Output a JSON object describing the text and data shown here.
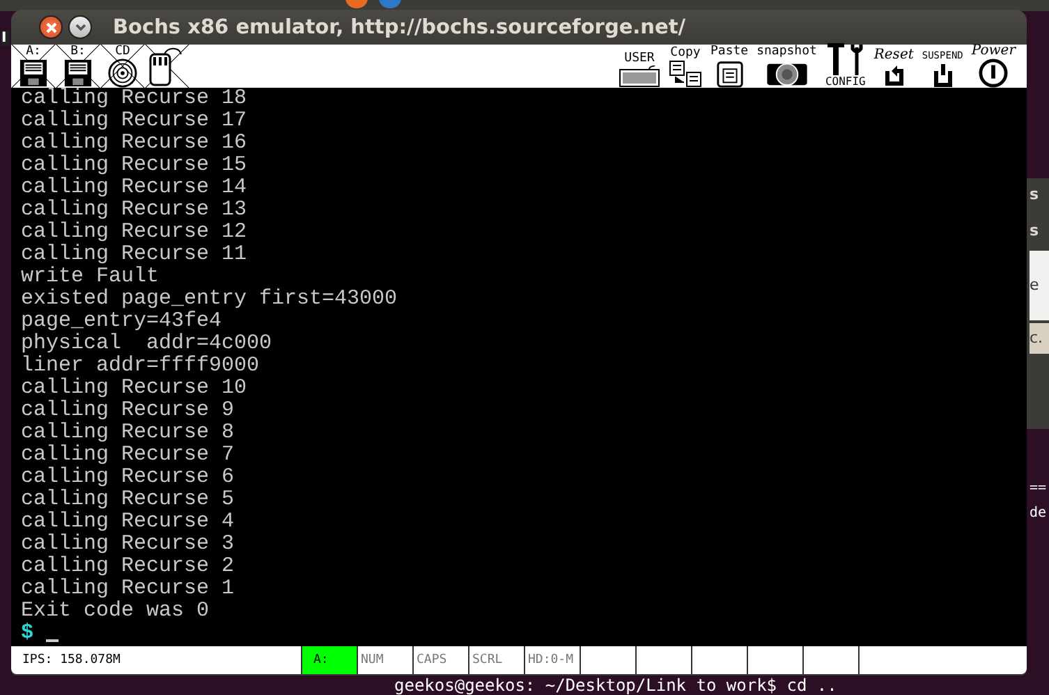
{
  "desktop": {
    "left_label": "I",
    "right_fragments": [
      {
        "text": "s",
        "kind": "dark"
      },
      {
        "text": "s",
        "kind": "dark"
      },
      {
        "text": "e",
        "kind": "light"
      },
      {
        "text": "c.",
        "kind": "beige"
      },
      {
        "text": "==",
        "kind": "term"
      },
      {
        "text": "de",
        "kind": "term"
      }
    ],
    "terminal_line": "geekos@geekos: ~/Desktop/Link to work$ cd .."
  },
  "window": {
    "title": "Bochs x86 emulator, http://bochs.sourceforge.net/"
  },
  "toolbar_left": [
    {
      "label": "A:",
      "kind": "floppy"
    },
    {
      "label": "B:",
      "kind": "floppy"
    },
    {
      "label": "CD",
      "kind": "cdrom"
    },
    {
      "kind": "mouse"
    }
  ],
  "toolbar_right": [
    {
      "label": "USER",
      "kind": "keyboard"
    },
    {
      "label": "Copy",
      "kind": "copy"
    },
    {
      "label": "Paste",
      "kind": "paste"
    },
    {
      "label": "snapshot",
      "kind": "camera"
    },
    {
      "label": "CONFIG",
      "kind": "config"
    },
    {
      "label": "Reset",
      "kind": "reset"
    },
    {
      "label": "SUSPEND",
      "kind": "suspend"
    },
    {
      "label": "Power",
      "kind": "power"
    }
  ],
  "console_lines": [
    {
      "text": "calling Recurse 18"
    },
    {
      "text": "calling Recurse 17"
    },
    {
      "text": "calling Recurse 16"
    },
    {
      "text": "calling Recurse 15"
    },
    {
      "text": "calling Recurse 14"
    },
    {
      "text": "calling Recurse 13"
    },
    {
      "text": "calling Recurse 12"
    },
    {
      "text": "calling Recurse 11"
    },
    {
      "text": "write Fault"
    },
    {
      "text": "existed page_entry first=43000"
    },
    {
      "text": "page_entry=43fe4"
    },
    {
      "text": "physical  addr=4c000"
    },
    {
      "text": "liner addr=ffff9000"
    },
    {
      "text": "calling Recurse 10"
    },
    {
      "text": "calling Recurse 9"
    },
    {
      "text": "calling Recurse 8"
    },
    {
      "text": "calling Recurse 7"
    },
    {
      "text": "calling Recurse 6"
    },
    {
      "text": "calling Recurse 5"
    },
    {
      "text": "calling Recurse 4"
    },
    {
      "text": "calling Recurse 3"
    },
    {
      "text": "calling Recurse 2"
    },
    {
      "text": "calling Recurse 1"
    },
    {
      "text": "Exit code was 0"
    }
  ],
  "prompt": "$",
  "status_bar": {
    "ips": "IPS: 158.078M",
    "indicators": [
      {
        "label": "A:",
        "on": true
      },
      {
        "label": "NUM",
        "on": false
      },
      {
        "label": "CAPS",
        "on": false
      },
      {
        "label": "SCRL",
        "on": false
      },
      {
        "label": "HD:0-M",
        "on": false
      }
    ]
  }
}
